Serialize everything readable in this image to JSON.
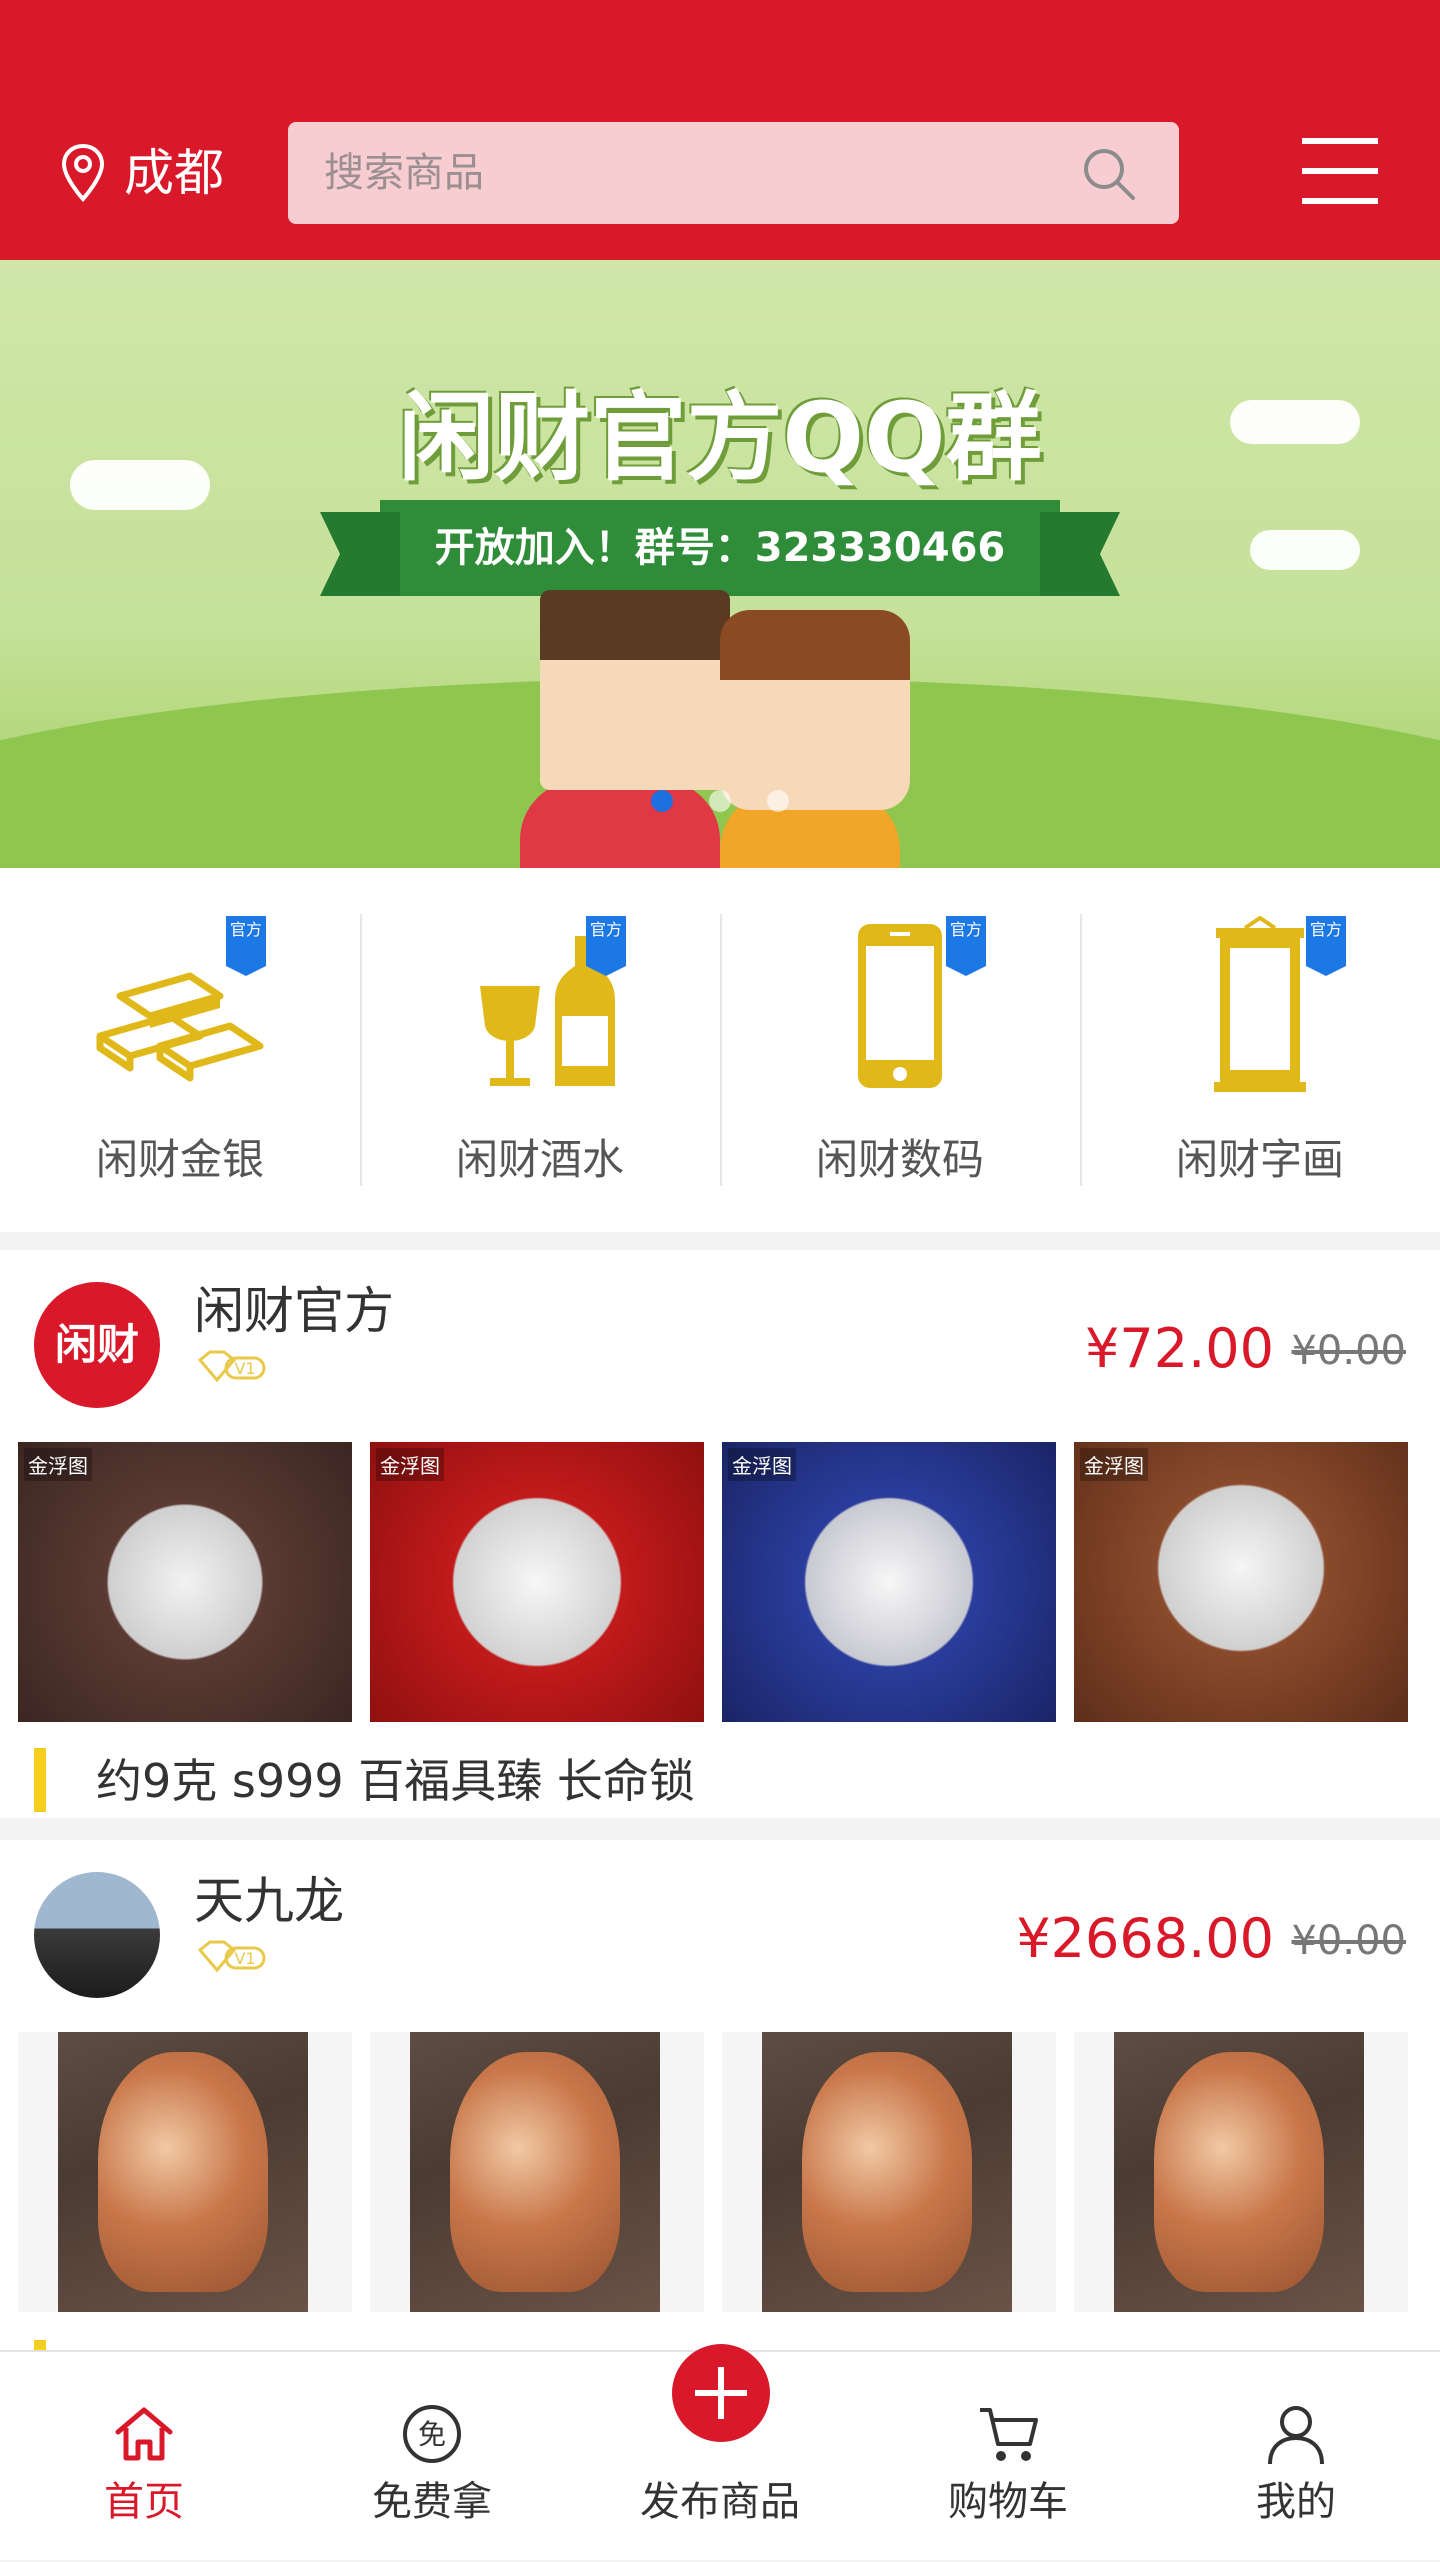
{
  "header": {
    "city": "成都",
    "search_placeholder": "搜索商品"
  },
  "banner": {
    "title": "闲财官方QQ群",
    "subtitle": "开放加入！群号：323330466",
    "slides": 3,
    "active_slide": 0
  },
  "categories": [
    {
      "label": "闲财金银",
      "badge": "官方",
      "icon": "gold-bar-icon"
    },
    {
      "label": "闲财酒水",
      "badge": "官方",
      "icon": "wine-icon"
    },
    {
      "label": "闲财数码",
      "badge": "官方",
      "icon": "phone-icon"
    },
    {
      "label": "闲财字画",
      "badge": "官方",
      "icon": "scroll-painting-icon"
    }
  ],
  "products": [
    {
      "seller": "闲财官方",
      "avatar_text": "闲财",
      "level": "V1",
      "price": "¥72.00",
      "original_price": "¥0.00",
      "thumb_brand": "金浮图",
      "title": "约9克 s999 百福具臻 长命锁"
    },
    {
      "seller": "天九龙",
      "level": "V1",
      "price": "¥2668.00",
      "original_price": "¥0.00"
    }
  ],
  "tabs": [
    {
      "label": "首页",
      "icon": "home-icon",
      "active": true
    },
    {
      "label": "免费拿",
      "icon": "free-icon",
      "active": false
    },
    {
      "label": "发布商品",
      "icon": "plus-icon",
      "active": false
    },
    {
      "label": "购物车",
      "icon": "cart-icon",
      "active": false
    },
    {
      "label": "我的",
      "icon": "user-icon",
      "active": false
    }
  ],
  "colors": {
    "brand_red": "#d9182a",
    "badge_blue": "#1c78e5",
    "accent_yellow": "#f6cf1e",
    "gold": "#e0b81a"
  }
}
